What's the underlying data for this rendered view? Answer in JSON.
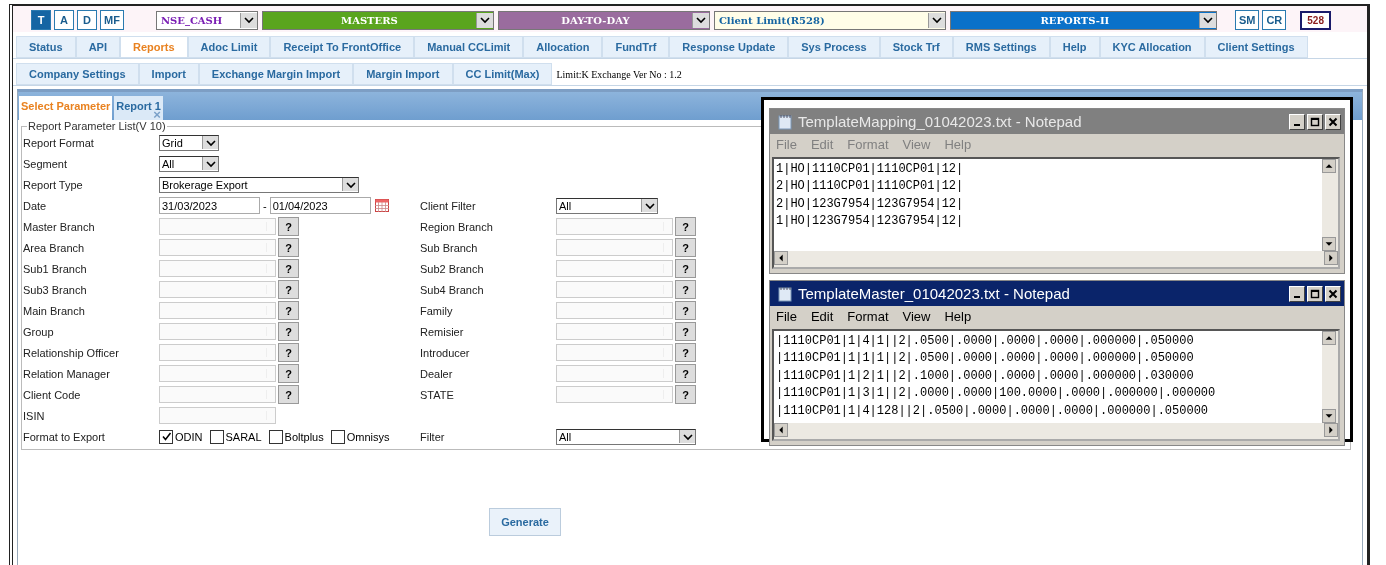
{
  "mode_buttons": [
    {
      "label": "T",
      "selected": true
    },
    {
      "label": "A",
      "selected": false
    },
    {
      "label": "D",
      "selected": false
    },
    {
      "label": "MF",
      "selected": false
    }
  ],
  "menus": [
    {
      "label": "NSE_CASH",
      "kind": "segment"
    },
    {
      "label": "MASTERS",
      "kind": "green"
    },
    {
      "label": "DAY-TO-DAY",
      "kind": "purple"
    },
    {
      "label": "Client Limit(R528)",
      "kind": "cream"
    },
    {
      "label": "REPORTS-II",
      "kind": "blue"
    }
  ],
  "right_buttons": [
    "SM",
    "CR"
  ],
  "user_badge": "528",
  "tabs": [
    {
      "label": "Status",
      "selected": false
    },
    {
      "label": "API",
      "selected": false
    },
    {
      "label": "Reports",
      "selected": true
    },
    {
      "label": "Adoc Limit",
      "selected": false
    },
    {
      "label": "Receipt To FrontOffice",
      "selected": false
    },
    {
      "label": "Manual CCLimit",
      "selected": false
    },
    {
      "label": "Allocation",
      "selected": false
    },
    {
      "label": "FundTrf",
      "selected": false
    },
    {
      "label": "Response Update",
      "selected": false
    },
    {
      "label": "Sys Process",
      "selected": false
    },
    {
      "label": "Stock Trf",
      "selected": false
    },
    {
      "label": "RMS Settings",
      "selected": false
    },
    {
      "label": "Help",
      "selected": false
    },
    {
      "label": "KYC Allocation",
      "selected": false
    },
    {
      "label": "Client Settings",
      "selected": false
    }
  ],
  "tabs_row2": [
    {
      "label": "Company Settings",
      "selected": false
    },
    {
      "label": "Import",
      "selected": false
    },
    {
      "label": "Exchange Margin Import",
      "selected": false
    },
    {
      "label": "Margin Import",
      "selected": false
    },
    {
      "label": "CC Limit(Max)",
      "selected": false
    }
  ],
  "version_info": "Limit:K Exchange Ver No : 1.2",
  "page_tabs": [
    {
      "label": "Select Parameter",
      "selected": true,
      "closable": false
    },
    {
      "label": "Report 1",
      "selected": false,
      "closable": true
    }
  ],
  "close_glyph": "×",
  "form": {
    "legend": "Report Parameter List(V 10)",
    "rows": [
      {
        "left": {
          "label": "Report Format",
          "kind": "select",
          "value": "Grid"
        }
      },
      {
        "left": {
          "label": "Segment",
          "kind": "select",
          "value": "All"
        }
      },
      {
        "left": {
          "label": "Report Type",
          "kind": "select-wide",
          "value": "Brokerage Export"
        }
      },
      {
        "left": {
          "label": "Date",
          "kind": "date-range",
          "from": "31/03/2023",
          "separator": "-",
          "to": "01/04/2023"
        },
        "right": {
          "label": "Client Filter",
          "kind": "select-right",
          "value": "All"
        }
      },
      {
        "left": {
          "label": "Master Branch",
          "kind": "lookup"
        },
        "right": {
          "label": "Region Branch",
          "kind": "lookup"
        }
      },
      {
        "left": {
          "label": "Area Branch",
          "kind": "lookup"
        },
        "right": {
          "label": "Sub Branch",
          "kind": "lookup"
        }
      },
      {
        "left": {
          "label": "Sub1 Branch",
          "kind": "lookup"
        },
        "right": {
          "label": "Sub2 Branch",
          "kind": "lookup"
        }
      },
      {
        "left": {
          "label": "Sub3 Branch",
          "kind": "lookup"
        },
        "right": {
          "label": "Sub4 Branch",
          "kind": "lookup"
        }
      },
      {
        "left": {
          "label": "Main Branch",
          "kind": "lookup"
        },
        "right": {
          "label": "Family",
          "kind": "lookup"
        }
      },
      {
        "left": {
          "label": "Group",
          "kind": "lookup"
        },
        "right": {
          "label": "Remisier",
          "kind": "lookup"
        }
      },
      {
        "left": {
          "label": "Relationship Officer",
          "kind": "lookup"
        },
        "right": {
          "label": "Introducer",
          "kind": "lookup"
        }
      },
      {
        "left": {
          "label": "Relation Manager",
          "kind": "lookup"
        },
        "right": {
          "label": "Dealer",
          "kind": "lookup"
        }
      },
      {
        "left": {
          "label": "Client Code",
          "kind": "lookup"
        },
        "right": {
          "label": "STATE",
          "kind": "lookup"
        }
      },
      {
        "left": {
          "label": "ISIN",
          "kind": "text"
        }
      },
      {
        "left": {
          "label": "Format to Export",
          "kind": "checks",
          "options": [
            {
              "label": "ODIN",
              "checked": true
            },
            {
              "label": "SARAL",
              "checked": false
            },
            {
              "label": "Boltplus",
              "checked": false
            },
            {
              "label": "Omnisys",
              "checked": false
            }
          ]
        },
        "right": {
          "label": "Filter",
          "kind": "select-wide-right",
          "value": "All"
        }
      }
    ],
    "lookup_glyph": "?"
  },
  "generate_button": "Generate",
  "notepads": [
    {
      "title": "TemplateMapping_01042023.txt - Notepad",
      "active": false,
      "menu": [
        "File",
        "Edit",
        "Format",
        "View",
        "Help"
      ],
      "lines": [
        "1|HO|1110CP01|1110CP01|12|",
        "2|HO|1110CP01|1110CP01|12|",
        "2|HO|123G7954|123G7954|12|",
        "1|HO|123G7954|123G7954|12|"
      ]
    },
    {
      "title": "TemplateMaster_01042023.txt - Notepad",
      "active": true,
      "menu": [
        "File",
        "Edit",
        "Format",
        "View",
        "Help"
      ],
      "lines": [
        "|1110CP01|1|4|1||2|.0500|.0000|.0000|.0000|.000000|.050000",
        "|1110CP01|1|1|1||2|.0500|.0000|.0000|.0000|.000000|.050000",
        "|1110CP01|1|2|1||2|.1000|.0000|.0000|.0000|.000000|.030000",
        "|1110CP01|1|3|1||2|.0000|.0000|100.0000|.0000|.000000|.000000",
        "|1110CP01|1|4|128||2|.0500|.0000|.0000|.0000|.000000|.050000"
      ]
    }
  ]
}
